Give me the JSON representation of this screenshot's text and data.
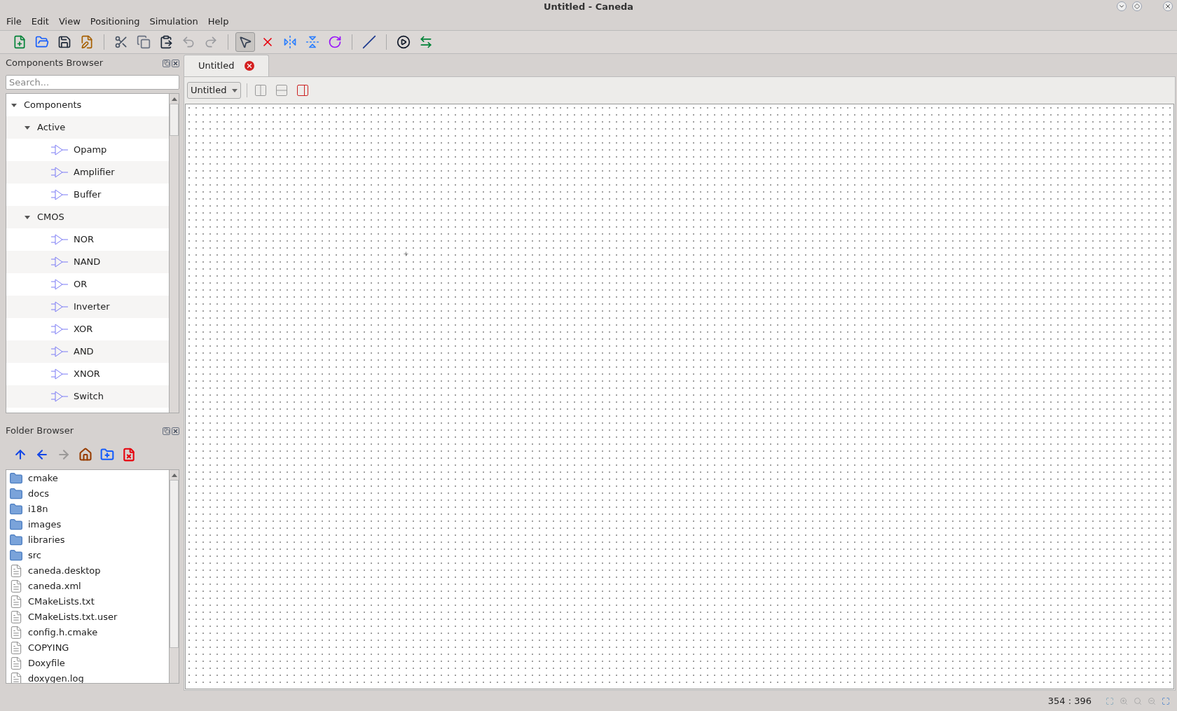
{
  "window": {
    "title": "Untitled - Caneda"
  },
  "menu": [
    "File",
    "Edit",
    "View",
    "Positioning",
    "Simulation",
    "Help"
  ],
  "toolbar": [
    {
      "disabled": false,
      "selected": false
    },
    {
      "disabled": false,
      "selected": false
    },
    {
      "disabled": false,
      "selected": false
    },
    {
      "disabled": false,
      "selected": false
    },
    {
      "disabled": false,
      "selected": false
    },
    {
      "disabled": false,
      "selected": false
    },
    {
      "disabled": false,
      "selected": false
    },
    {
      "disabled": true,
      "selected": false
    },
    {
      "disabled": true,
      "selected": false
    },
    {
      "disabled": false,
      "selected": true
    },
    {
      "disabled": false,
      "selected": false
    },
    {
      "disabled": false,
      "selected": false
    },
    {
      "disabled": false,
      "selected": false
    },
    {
      "disabled": false,
      "selected": false
    },
    {
      "disabled": false,
      "selected": false
    },
    {
      "disabled": false,
      "selected": false
    },
    {
      "disabled": false,
      "selected": false
    }
  ],
  "components_browser": {
    "title": "Components Browser",
    "search": {
      "placeholder": "Search..."
    },
    "tree": [
      {
        "label": "Components",
        "expanded": true,
        "children": [
          {
            "label": "Active",
            "expanded": true,
            "children": [
              {
                "label": "Opamp"
              },
              {
                "label": "Amplifier"
              },
              {
                "label": "Buffer"
              }
            ]
          },
          {
            "label": "CMOS",
            "expanded": true,
            "children": [
              {
                "label": "NOR"
              },
              {
                "label": "NAND"
              },
              {
                "label": "OR"
              },
              {
                "label": "Inverter"
              },
              {
                "label": "XOR"
              },
              {
                "label": "AND"
              },
              {
                "label": "XNOR"
              },
              {
                "label": "Switch"
              }
            ]
          }
        ]
      }
    ]
  },
  "folder_browser": {
    "title": "Folder Browser",
    "toolbar": [
      {
        "disabled": false
      },
      {
        "disabled": false
      },
      {
        "disabled": true
      },
      {
        "disabled": false
      },
      {
        "disabled": false
      },
      {
        "disabled": false
      }
    ],
    "files": [
      {
        "name": "cmake",
        "kind": "folder"
      },
      {
        "name": "docs",
        "kind": "folder"
      },
      {
        "name": "i18n",
        "kind": "folder"
      },
      {
        "name": "images",
        "kind": "folder"
      },
      {
        "name": "libraries",
        "kind": "folder"
      },
      {
        "name": "src",
        "kind": "folder"
      },
      {
        "name": "caneda.desktop",
        "kind": "file"
      },
      {
        "name": "caneda.xml",
        "kind": "file"
      },
      {
        "name": "CMakeLists.txt",
        "kind": "file"
      },
      {
        "name": "CMakeLists.txt.user",
        "kind": "file"
      },
      {
        "name": "config.h.cmake",
        "kind": "file"
      },
      {
        "name": "COPYING",
        "kind": "file"
      },
      {
        "name": "Doxyfile",
        "kind": "file"
      },
      {
        "name": "doxygen.log",
        "kind": "file"
      }
    ]
  },
  "tabs": [
    {
      "label": "Untitled",
      "selected": true
    }
  ],
  "view_selector": {
    "value": "Untitled"
  },
  "status_bar": {
    "coordinates": "354 : 396"
  }
}
